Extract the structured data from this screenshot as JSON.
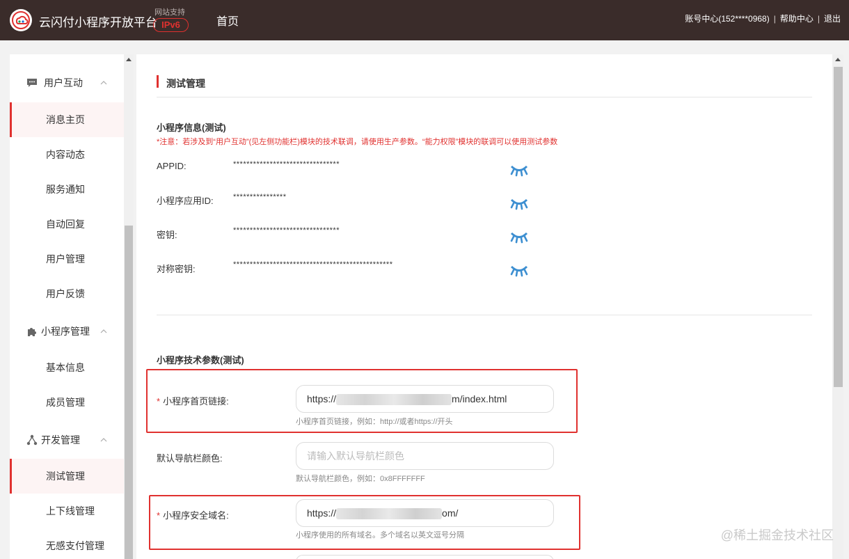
{
  "header": {
    "brand": "云闪付小程序开放平台",
    "ipv6_tip": "网站支持",
    "ipv6_badge": "IPv6",
    "home": "首页",
    "account": "账号中心(152****0968)",
    "help": "帮助中心",
    "logout": "退出",
    "sep": "|"
  },
  "sidebar": {
    "groups": {
      "interaction": "用户互动",
      "miniapp": "小程序管理",
      "dev": "开发管理"
    },
    "items": [
      "消息主页",
      "内容动态",
      "服务通知",
      "自动回复",
      "用户管理",
      "用户反馈",
      "基本信息",
      "成员管理",
      "测试管理",
      "上下线管理",
      "无感支付管理"
    ]
  },
  "main": {
    "page_title": "测试管理",
    "info": {
      "title": "小程序信息(测试)",
      "notice": "*注意：若涉及到“用户互动”(见左侧功能栏)模块的技术联调，请使用生产参数。“能力权限”模块的联调可以使用测试参数",
      "rows": [
        {
          "label": "APPID:",
          "value": "********************************"
        },
        {
          "label": "小程序应用ID:",
          "value": "****************"
        },
        {
          "label": "密钥:",
          "value": "********************************"
        },
        {
          "label": "对称密钥:",
          "value": "************************************************"
        }
      ]
    },
    "tech": {
      "title": "小程序技术参数(测试)",
      "homepage": {
        "label": "小程序首页链接:",
        "value_prefix": "https://",
        "value_suffix": "m/index.html",
        "hint": "小程序首页链接，例如：http://或者https://开头"
      },
      "navbar": {
        "label": "默认导航栏颜色:",
        "placeholder": "请输入默认导航栏颜色",
        "hint": "默认导航栏颜色，例如：0x8FFFFFFF"
      },
      "domain": {
        "label": "小程序安全域名:",
        "value_prefix": "https://",
        "value_suffix": "om/",
        "hint": "小程序使用的所有域名。多个域名以英文逗号分隔"
      },
      "required_mark": "*"
    }
  },
  "watermark": "@稀土掘金技术社区",
  "colors": {
    "header_bg": "#3a2c2a",
    "accent": "#e0312f",
    "eye_icon": "#3d8fd1"
  }
}
